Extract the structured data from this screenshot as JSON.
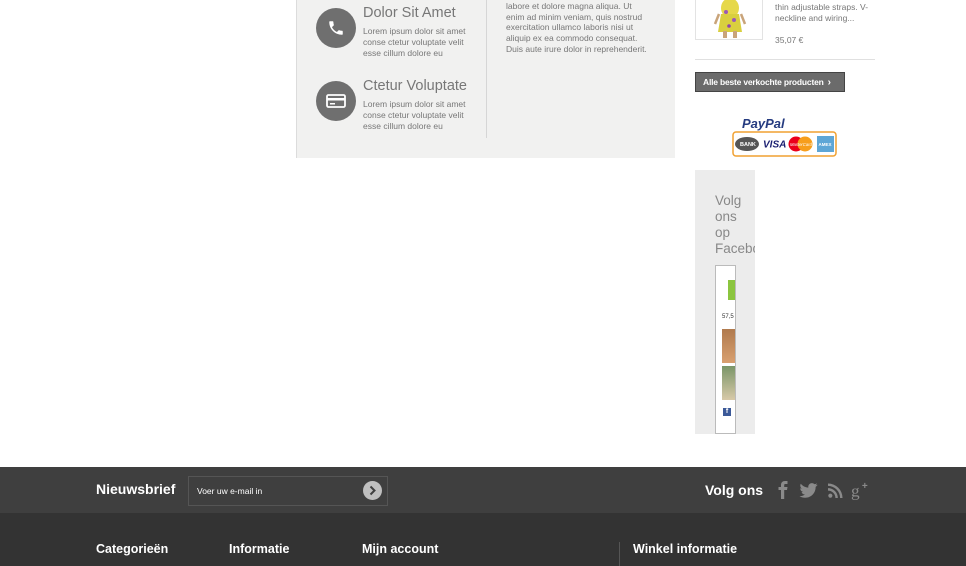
{
  "info_block": {
    "items": [
      {
        "title": "Dolor Sit Amet",
        "desc": "Lorem ipsum dolor sit amet conse ctetur voluptate velit esse cillum dolore eu",
        "icon": "phone-icon"
      },
      {
        "title": "Ctetur Voluptate",
        "desc": "Lorem ipsum dolor sit amet conse ctetur voluptate velit esse cillum dolore eu",
        "icon": "credit-card-icon"
      }
    ],
    "text": "labore et dolore magna aliqua. Ut enim ad minim veniam, quis nostrud exercitation ullamco laboris nisi ut aliquip ex ea commodo consequat. Duis aute irure dolor in reprehenderit."
  },
  "product": {
    "desc": "thin adjustable straps. V-neckline and wiring...",
    "price": "35,07 €"
  },
  "bestsellers_button": {
    "label": "Alle beste verkochte producten",
    "icon": "chevron-right-icon"
  },
  "paypal": {
    "logo_text": "PayPal",
    "cards": [
      "BANK",
      "VISA",
      "MasterCard",
      "AMEX"
    ]
  },
  "facebook": {
    "title": "Volg ons op Facebook",
    "count": "57,5"
  },
  "footer": {
    "newsletter": {
      "label": "Nieuwsbrief",
      "placeholder": "Voer uw e-mail in"
    },
    "follow": {
      "label": "Volg ons",
      "icons": [
        "facebook-icon",
        "twitter-icon",
        "rss-icon",
        "google-plus-icon"
      ]
    },
    "columns": [
      "Categorieën",
      "Informatie",
      "Mijn account",
      "Winkel informatie"
    ]
  },
  "colors": {
    "footer_top": "#3f3f3f",
    "footer_bottom": "#333333",
    "info_bg": "#f1f1f0",
    "button_bg": "#6b6b6b",
    "paypal_blue": "#253b80"
  }
}
